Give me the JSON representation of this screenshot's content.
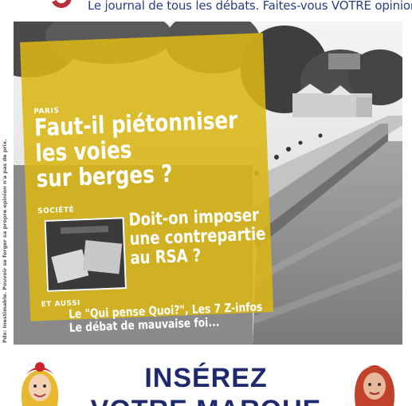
{
  "masthead": {
    "tagline": "Le journal de tous les débats. Faites-vous VOTRE opinion."
  },
  "cover": {
    "photo_credit": "Pdx: Inestimable. Pouvoir se forger sa propre opinion n'a pas de prix.",
    "section_paris": "PARIS",
    "headline_main": [
      "Faut-il piétonniser",
      "les voies",
      "sur berges ?"
    ],
    "section_societe": "SOCIÉTÉ",
    "headline_rsa": [
      "Doit-on imposer",
      "une contrepartie",
      "au RSA ?"
    ],
    "section_aussi": "ET AUSSI",
    "headline_aussi": [
      "Le \"Qui pense Quoi?\", Les 7 Z-infos",
      "Le débat de mauvaise foi..."
    ]
  },
  "cta": {
    "line1": "INSÉREZ",
    "line2": "VOTRE MARQUE"
  },
  "colors": {
    "brand_blue": "#2c3c88",
    "brand_red": "#b8303d",
    "panel_yellow": "#dab614",
    "cta_blue": "#1f2a6e"
  }
}
